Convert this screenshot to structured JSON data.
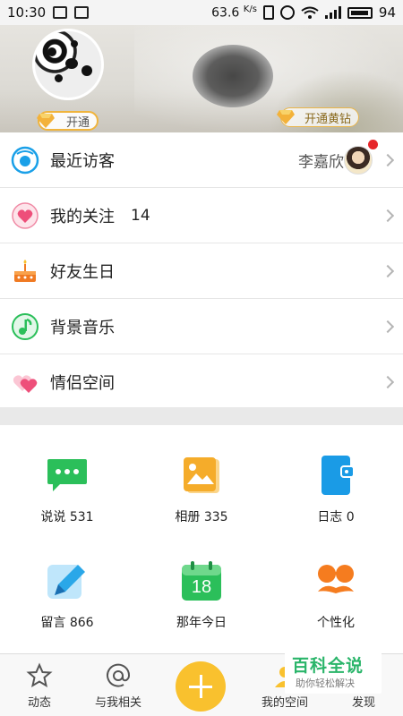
{
  "status_bar": {
    "time": "10:30",
    "speed": "63.6",
    "speed_unit": "K/s",
    "battery": "94"
  },
  "header": {
    "vip_badge_label": "开通",
    "gold_button_label": "开通黄钻"
  },
  "list": {
    "recent_visitors": {
      "label": "最近访客",
      "visitor_name": "李嘉欣"
    },
    "following": {
      "label": "我的关注",
      "count": "14"
    },
    "birthdays": {
      "label": "好友生日"
    },
    "music": {
      "label": "背景音乐"
    },
    "couple_space": {
      "label": "情侣空间"
    }
  },
  "grid": {
    "items": [
      {
        "label": "说说 531",
        "icon": "chat-bubble-icon",
        "color": "#2bbf5a"
      },
      {
        "label": "相册 335",
        "icon": "photo-album-icon",
        "color": "#f5ac2a"
      },
      {
        "label": "日志 0",
        "icon": "journal-icon",
        "color": "#1a9be6"
      },
      {
        "label": "留言 866",
        "icon": "pen-message-icon",
        "color": "#2aa7e8"
      },
      {
        "label": "那年今日",
        "icon": "calendar-icon",
        "color": "#2bbf5a"
      },
      {
        "label": "个性化",
        "icon": "mustache-glasses-icon",
        "color": "#f57c1f"
      }
    ],
    "calendar_day": "18"
  },
  "tabbar": {
    "tabs": [
      {
        "label": "动态",
        "icon": "star-icon"
      },
      {
        "label": "与我相关",
        "icon": "at-icon"
      },
      {
        "label": "我的空间",
        "icon": "my-space-icon"
      },
      {
        "label": "发现",
        "icon": "discover-icon"
      }
    ]
  },
  "watermark": {
    "title": "百科全说",
    "subtitle": "助你轻松解决"
  },
  "colors": {
    "accent_yellow": "#f9c12e",
    "red_dot": "#e6262a"
  }
}
